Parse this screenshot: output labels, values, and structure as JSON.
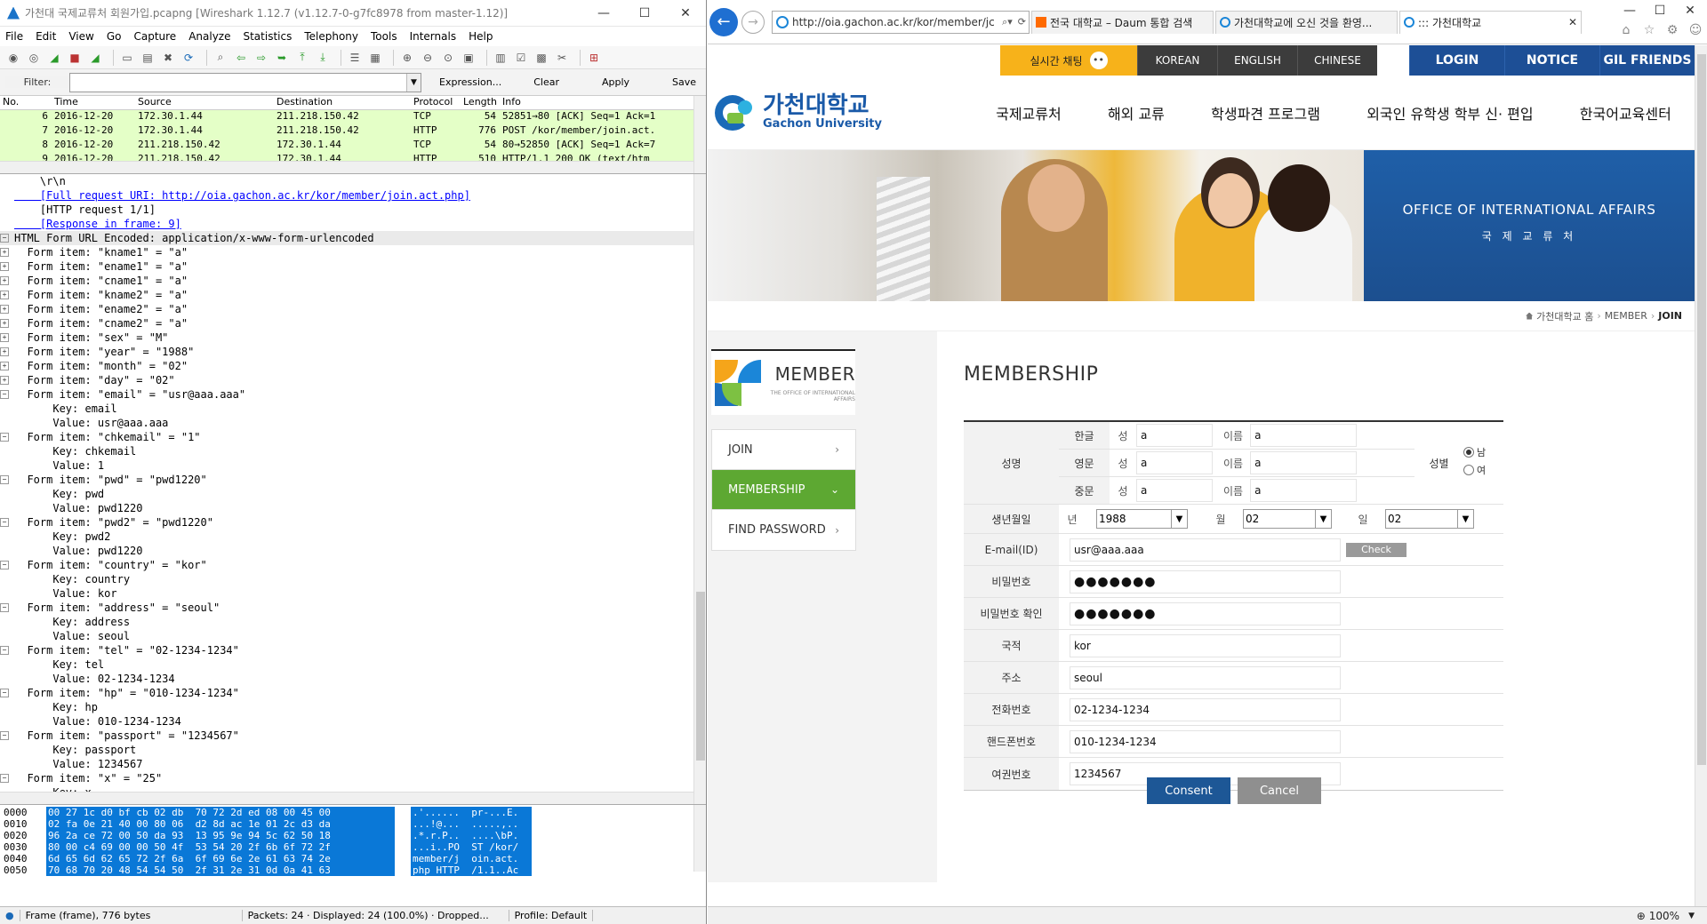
{
  "wireshark": {
    "title": "가천대 국제교류처 회원가입.pcapng  [Wireshark 1.12.7  (v1.12.7-0-g7fc8978 from master-1.12)]",
    "menu": [
      "File",
      "Edit",
      "View",
      "Go",
      "Capture",
      "Analyze",
      "Statistics",
      "Telephony",
      "Tools",
      "Internals",
      "Help"
    ],
    "filter": {
      "label": "Filter:",
      "value": "",
      "buttons": [
        "Expression...",
        "Clear",
        "Apply",
        "Save"
      ]
    },
    "columns": [
      "No.",
      "Time",
      "Source",
      "Destination",
      "Protocol",
      "Length",
      "Info"
    ],
    "packets": [
      {
        "no": "6",
        "time": "2016-12-20",
        "src": "172.30.1.44",
        "dst": "211.218.150.42",
        "proto": "TCP",
        "len": "54",
        "info": "52851→80 [ACK] Seq=1 Ack=1"
      },
      {
        "no": "7",
        "time": "2016-12-20",
        "src": "172.30.1.44",
        "dst": "211.218.150.42",
        "proto": "HTTP",
        "len": "776",
        "info": "POST /kor/member/join.act."
      },
      {
        "no": "8",
        "time": "2016-12-20",
        "src": "211.218.150.42",
        "dst": "172.30.1.44",
        "proto": "TCP",
        "len": "54",
        "info": "80→52850 [ACK] Seq=1 Ack=7"
      },
      {
        "no": "9",
        "time": "2016-12-20",
        "src": "211.218.150.42",
        "dst": "172.30.1.44",
        "proto": "HTTP",
        "len": "510",
        "info": "HTTP/1.1 200 OK  (text/htm"
      }
    ],
    "details": [
      {
        "t": "    \\r\\n",
        "e": "none"
      },
      {
        "t": "    [Full request URI: http://oia.gachon.ac.kr/kor/member/join.act.php]",
        "e": "none",
        "link": true
      },
      {
        "t": "    [HTTP request 1/1]",
        "e": "none"
      },
      {
        "t": "    [Response in frame: 9]",
        "e": "none",
        "link": true
      },
      {
        "t": "HTML Form URL Encoded: application/x-www-form-urlencoded",
        "e": "minus",
        "sel": true
      },
      {
        "t": "  Form item: \"kname1\" = \"a\"",
        "e": "plus"
      },
      {
        "t": "  Form item: \"ename1\" = \"a\"",
        "e": "plus"
      },
      {
        "t": "  Form item: \"cname1\" = \"a\"",
        "e": "plus"
      },
      {
        "t": "  Form item: \"kname2\" = \"a\"",
        "e": "plus"
      },
      {
        "t": "  Form item: \"ename2\" = \"a\"",
        "e": "plus"
      },
      {
        "t": "  Form item: \"cname2\" = \"a\"",
        "e": "plus"
      },
      {
        "t": "  Form item: \"sex\" = \"M\"",
        "e": "plus"
      },
      {
        "t": "  Form item: \"year\" = \"1988\"",
        "e": "plus"
      },
      {
        "t": "  Form item: \"month\" = \"02\"",
        "e": "plus"
      },
      {
        "t": "  Form item: \"day\" = \"02\"",
        "e": "plus"
      },
      {
        "t": "  Form item: \"email\" = \"usr@aaa.aaa\"",
        "e": "minus"
      },
      {
        "t": "      Key: email",
        "e": "none"
      },
      {
        "t": "      Value: usr@aaa.aaa",
        "e": "none"
      },
      {
        "t": "  Form item: \"chkemail\" = \"1\"",
        "e": "minus"
      },
      {
        "t": "      Key: chkemail",
        "e": "none"
      },
      {
        "t": "      Value: 1",
        "e": "none"
      },
      {
        "t": "  Form item: \"pwd\" = \"pwd1220\"",
        "e": "minus"
      },
      {
        "t": "      Key: pwd",
        "e": "none"
      },
      {
        "t": "      Value: pwd1220",
        "e": "none"
      },
      {
        "t": "  Form item: \"pwd2\" = \"pwd1220\"",
        "e": "minus"
      },
      {
        "t": "      Key: pwd2",
        "e": "none"
      },
      {
        "t": "      Value: pwd1220",
        "e": "none"
      },
      {
        "t": "  Form item: \"country\" = \"kor\"",
        "e": "minus"
      },
      {
        "t": "      Key: country",
        "e": "none"
      },
      {
        "t": "      Value: kor",
        "e": "none"
      },
      {
        "t": "  Form item: \"address\" = \"seoul\"",
        "e": "minus"
      },
      {
        "t": "      Key: address",
        "e": "none"
      },
      {
        "t": "      Value: seoul",
        "e": "none"
      },
      {
        "t": "  Form item: \"tel\" = \"02-1234-1234\"",
        "e": "minus"
      },
      {
        "t": "      Key: tel",
        "e": "none"
      },
      {
        "t": "      Value: 02-1234-1234",
        "e": "none"
      },
      {
        "t": "  Form item: \"hp\" = \"010-1234-1234\"",
        "e": "minus"
      },
      {
        "t": "      Key: hp",
        "e": "none"
      },
      {
        "t": "      Value: 010-1234-1234",
        "e": "none"
      },
      {
        "t": "  Form item: \"passport\" = \"1234567\"",
        "e": "minus"
      },
      {
        "t": "      Key: passport",
        "e": "none"
      },
      {
        "t": "      Value: 1234567",
        "e": "none"
      },
      {
        "t": "  Form item: \"x\" = \"25\"",
        "e": "minus"
      },
      {
        "t": "      Key: x",
        "e": "none"
      }
    ],
    "hex": [
      {
        "off": "0000",
        "bytes": "00 27 1c d0 bf cb 02 db  70 72 2d ed 08 00 45 00",
        "ascii": ".'......  pr-...E."
      },
      {
        "off": "0010",
        "bytes": "02 fa 0e 21 40 00 80 06  d2 8d ac 1e 01 2c d3 da",
        "ascii": "...!@...  .....,.."
      },
      {
        "off": "0020",
        "bytes": "96 2a ce 72 00 50 da 93  13 95 9e 94 5c 62 50 18",
        "ascii": ".*.r.P..  ....\\bP."
      },
      {
        "off": "0030",
        "bytes": "80 00 c4 69 00 00 50 4f  53 54 20 2f 6b 6f 72 2f",
        "ascii": "...i..PO  ST /kor/"
      },
      {
        "off": "0040",
        "bytes": "6d 65 6d 62 65 72 2f 6a  6f 69 6e 2e 61 63 74 2e",
        "ascii": "member/j  oin.act."
      },
      {
        "off": "0050",
        "bytes": "70 68 70 20 48 54 54 50  2f 31 2e 31 0d 0a 41 63",
        "ascii": "php HTTP  /1.1..Ac"
      }
    ],
    "status": [
      "Frame (frame), 776 bytes",
      "Packets: 24 · Displayed: 24 (100.0%) · Dropped...",
      "Profile: Default"
    ]
  },
  "browser": {
    "url": "http://oia.gachon.ac.kr/kor/member/jc",
    "tabs": [
      {
        "label": "전국 대학교 – Daum 통합 검색",
        "active": false,
        "color": "#ff6a00"
      },
      {
        "label": "가천대학교에 오신 것을 환영...",
        "active": false,
        "color": "#1b86d8"
      },
      {
        "label": "::: 가천대학교",
        "active": true,
        "color": "#1b86d8"
      }
    ],
    "zoom": "100%"
  },
  "site": {
    "chat": "실시간 채팅",
    "langs": [
      "KOREAN",
      "ENGLISH",
      "CHINESE"
    ],
    "util": [
      "LOGIN",
      "NOTICE",
      "GIL FRIENDS"
    ],
    "logo_ko": "가천대학교",
    "logo_en": "Gachon University",
    "gnb": [
      "국제교류처",
      "해외 교류",
      "학생파견 프로그램",
      "외국인 유학생 학부 신· 편입",
      "한국어교육센터"
    ],
    "banner_title": "OFFICE OF INTERNATIONAL AFFAIRS",
    "banner_sub": "국 제 교 류 처",
    "breadcrumb": [
      "가천대학교 홈",
      "MEMBER",
      "JOIN"
    ],
    "lnb_title": "MEMBER",
    "lnb_sub": "THE OFFICE OF INTERNATIONAL AFFAIRS",
    "lnb_items": [
      {
        "label": "JOIN",
        "active": false,
        "arrow": "›"
      },
      {
        "label": "MEMBERSHIP",
        "active": true,
        "arrow": "⌄"
      },
      {
        "label": "FIND PASSWORD",
        "active": false,
        "arrow": "›"
      }
    ],
    "page_title": "MEMBERSHIP"
  },
  "form": {
    "name_label": "성명",
    "name_rows": [
      {
        "lang": "한글",
        "surname_label": "성",
        "surname": "a",
        "given_label": "이름",
        "given": "a"
      },
      {
        "lang": "영문",
        "surname_label": "성",
        "surname": "a",
        "given_label": "이름",
        "given": "a"
      },
      {
        "lang": "중문",
        "surname_label": "성",
        "surname": "a",
        "given_label": "이름",
        "given": "a"
      }
    ],
    "sex_label": "성별",
    "sex_options": [
      {
        "label": "남",
        "checked": true
      },
      {
        "label": "여",
        "checked": false
      }
    ],
    "birth_label": "생년월일",
    "year_label": "년",
    "year": "1988",
    "month_label": "월",
    "month": "02",
    "day_label": "일",
    "day": "02",
    "email_label": "E-mail(ID)",
    "email": "usr@aaa.aaa",
    "check_button": "Check",
    "pwd_label": "비밀번호",
    "pwd_mask": "●●●●●●●",
    "pwd2_label": "비밀번호 확인",
    "pwd2_mask": "●●●●●●●",
    "country_label": "국적",
    "country": "kor",
    "address_label": "주소",
    "address": "seoul",
    "tel_label": "전화번호",
    "tel": "02-1234-1234",
    "hp_label": "핸드폰번호",
    "hp": "010-1234-1234",
    "passport_label": "여권번호",
    "passport": "1234567",
    "consent_button": "Consent",
    "cancel_button": "Cancel"
  }
}
